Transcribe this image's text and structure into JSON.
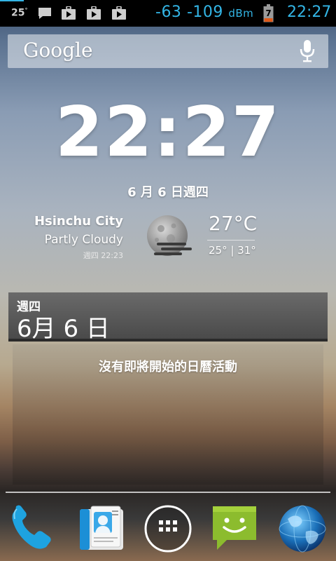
{
  "status_bar": {
    "temperature": "25",
    "temperature_unit": "°",
    "icons": [
      "message-icon",
      "play-store-icon",
      "play-store-icon",
      "play-store-icon"
    ],
    "signal_a": "-63",
    "signal_b": "-109",
    "signal_unit": "dBm",
    "battery_level": "7",
    "time": "22:27",
    "accent_color": "#33b5e5"
  },
  "search": {
    "logo_text": "Google",
    "mic_icon": "mic-icon"
  },
  "clock": {
    "time": "22:27",
    "date": "6 月 6 日週四"
  },
  "weather": {
    "city": "Hsinchu City",
    "condition": "Partly Cloudy",
    "updated": "週四 22:23",
    "icon": "moon-fog-icon",
    "current_temp": "27°C",
    "range": "25° | 31°"
  },
  "calendar": {
    "weekday": "週四",
    "date": "6月 6 日",
    "empty_message": "沒有即將開始的日曆活動"
  },
  "dock": {
    "items": [
      "phone-icon",
      "contacts-icon",
      "app-drawer-icon",
      "messaging-icon",
      "browser-icon"
    ]
  }
}
